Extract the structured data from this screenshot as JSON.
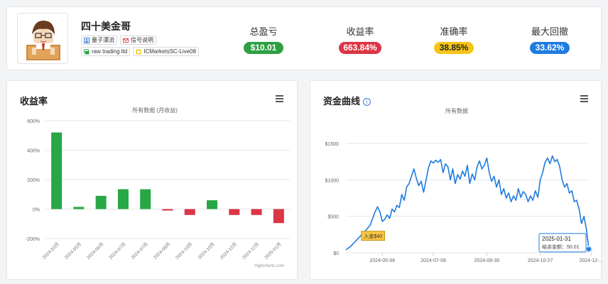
{
  "profile": {
    "name": "四十美金哥",
    "tags_row1": [
      {
        "label": "量子漂流",
        "icon": "user-badge-icon",
        "color": "#3a7bd5"
      },
      {
        "label": "信号说明",
        "icon": "mail-icon",
        "color": "#e0474c"
      }
    ],
    "tags_row2": [
      {
        "label": "raw trading ltd",
        "icon": "broker-icon",
        "color": "#2ea043"
      },
      {
        "label": "ICMarketsSC-Live08",
        "icon": "server-icon",
        "color": "#e0b100"
      }
    ]
  },
  "stats": [
    {
      "label": "总盈亏",
      "value": "$10.01",
      "color": "#2ea043"
    },
    {
      "label": "收益率",
      "value": "663.84%",
      "color": "#dc3545"
    },
    {
      "label": "准确率",
      "value": "38.85%",
      "color": "#f5c518"
    },
    {
      "label": "最大回撤",
      "value": "33.62%",
      "color": "#1e7be0"
    }
  ],
  "returns_chart": {
    "title": "收益率",
    "subtitle": "所有数据 (月收益)",
    "credit": "Highcharts.com"
  },
  "equity_chart": {
    "title": "资金曲线",
    "subtitle": "所有数据",
    "deposit_label": "入金$40",
    "tooltip_date": "2025-01-31",
    "tooltip_value": "结余金额：50.01"
  },
  "chart_data": [
    {
      "type": "bar",
      "title": "收益率",
      "subtitle": "所有数据 (月收益)",
      "categories": [
        "2024-03月",
        "2024-05月",
        "2024-06月",
        "2024-07月",
        "2024-07月",
        "2024-08月",
        "2024-10月",
        "2024-10月",
        "2024-12月",
        "2024-12月",
        "2025-01月"
      ],
      "values": [
        520,
        15,
        90,
        135,
        135,
        -10,
        -40,
        60,
        -40,
        -40,
        -95
      ],
      "colors": {
        "positive": "#28a745",
        "negative": "#dc3545"
      },
      "yticks": [
        "-200%",
        "0%",
        "200%",
        "400%",
        "600%"
      ],
      "ylim": [
        -200,
        600
      ],
      "grid": true
    },
    {
      "type": "line",
      "title": "资金曲线",
      "subtitle": "所有数据",
      "x_ticks": [
        "2024-05-06",
        "2024-07-08",
        "2024-08-30",
        "2024-10-27",
        "2024-12-..."
      ],
      "yticks": [
        "$0",
        "$500",
        "$1000",
        "$1500"
      ],
      "ylim": [
        0,
        1500
      ],
      "line_color": "#1e7be0",
      "series": [
        {
          "x": [
            0,
            2,
            4,
            6,
            8,
            10,
            12,
            13,
            14,
            15,
            16,
            17,
            18,
            19,
            20,
            21,
            22,
            23,
            24,
            25,
            26,
            27,
            28,
            29,
            30,
            31,
            32,
            33,
            34,
            35,
            36,
            37,
            38,
            39,
            40,
            41,
            42,
            43,
            44,
            45,
            46,
            47,
            48,
            49,
            50,
            51,
            52,
            53,
            54,
            55,
            56,
            57,
            58,
            59,
            60,
            61,
            62,
            63,
            64,
            65,
            66,
            67,
            68,
            69,
            70,
            71,
            72,
            73,
            74,
            75,
            76,
            77,
            78,
            79,
            80,
            81,
            82,
            83,
            84,
            85,
            86,
            87,
            88,
            89,
            90,
            91,
            92,
            93,
            94,
            95,
            96,
            97,
            98,
            99,
            100
          ],
          "y": [
            40,
            90,
            160,
            230,
            300,
            380,
            560,
            630,
            560,
            430,
            460,
            520,
            470,
            600,
            560,
            650,
            620,
            800,
            720,
            900,
            950,
            1050,
            1150,
            1020,
            920,
            980,
            830,
            1000,
            1170,
            1260,
            1230,
            1270,
            1240,
            1280,
            1100,
            1220,
            1180,
            1000,
            1150,
            950,
            1070,
            1010,
            1120,
            1050,
            1200,
            950,
            1080,
            1000,
            1180,
            1260,
            1150,
            1200,
            1300,
            1100,
            980,
            1050,
            900,
            1000,
            800,
            880,
            750,
            820,
            700,
            780,
            720,
            880,
            760,
            840,
            800,
            700,
            780,
            720,
            850,
            760,
            1000,
            1100,
            1240,
            1300,
            1220,
            1330,
            1250,
            1280,
            1180,
            1000,
            900,
            950,
            820,
            850,
            700,
            720,
            600,
            400,
            500,
            320,
            50
          ]
        }
      ]
    }
  ]
}
